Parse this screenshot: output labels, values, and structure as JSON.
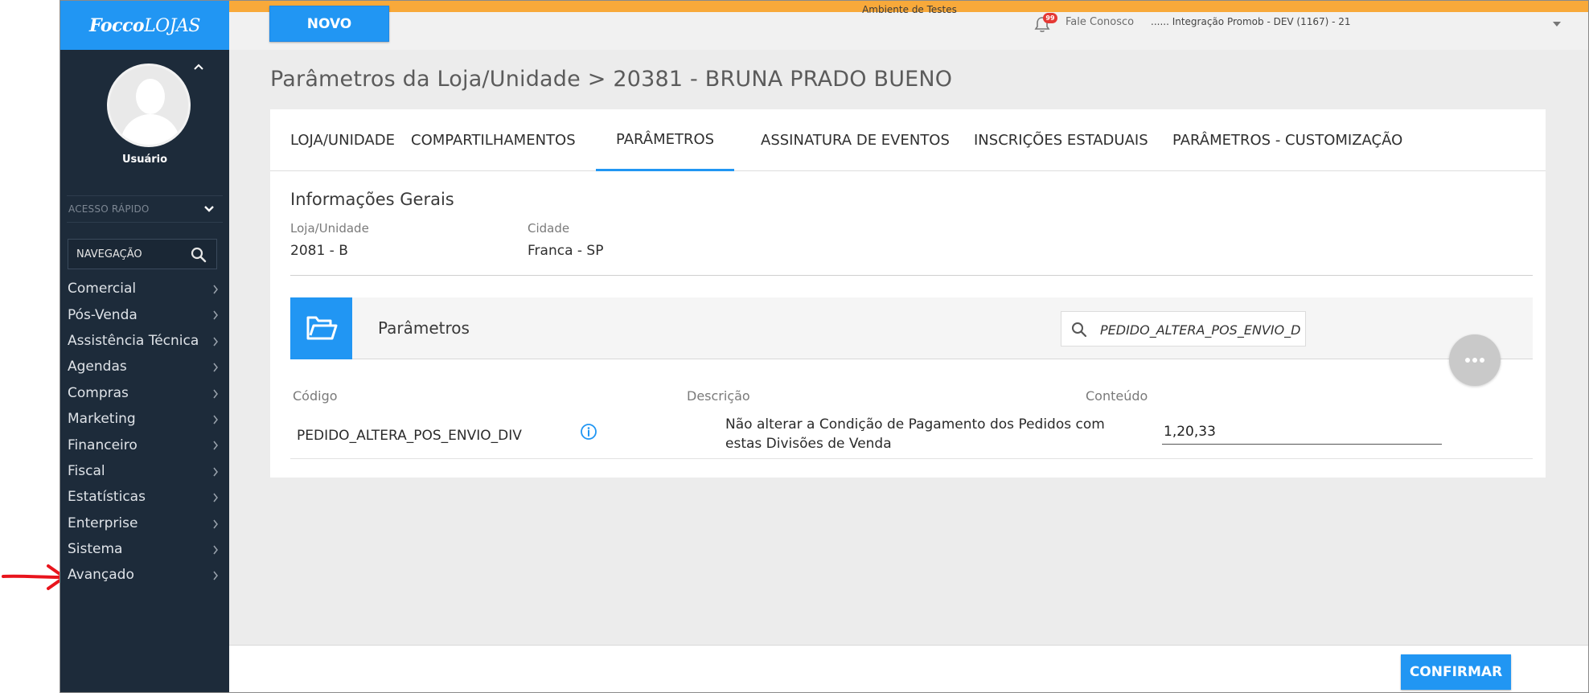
{
  "app": {
    "logo": {
      "bold": "Focco",
      "rest": "LOJAS"
    }
  },
  "environment_banner": "Ambiente de Testes",
  "topbar": {
    "new_button": "NOVO",
    "notification_count": "99",
    "contact": "Fale Conosco",
    "context": "...... Integração Promob - DEV (1167) - 21"
  },
  "sidebar": {
    "user_label": "Usuário",
    "quick_access": "ACESSO RÁPIDO",
    "nav_search": "NAVEGAÇÃO",
    "items": [
      {
        "label": "Comercial"
      },
      {
        "label": "Pós-Venda"
      },
      {
        "label": "Assistência Técnica"
      },
      {
        "label": "Agendas"
      },
      {
        "label": "Compras"
      },
      {
        "label": "Marketing"
      },
      {
        "label": "Financeiro"
      },
      {
        "label": "Fiscal"
      },
      {
        "label": "Estatísticas"
      },
      {
        "label": "Enterprise"
      },
      {
        "label": "Sistema"
      },
      {
        "label": "Avançado"
      }
    ]
  },
  "page": {
    "title": "Parâmetros da Loja/Unidade > 20381 - BRUNA PRADO BUENO",
    "tabs": [
      {
        "label": "LOJA/UNIDADE",
        "active": false
      },
      {
        "label": "COMPARTILHAMENTOS",
        "active": false
      },
      {
        "label": "PARÂMETROS",
        "active": true
      },
      {
        "label": "ASSINATURA DE EVENTOS",
        "active": false
      },
      {
        "label": "INSCRIÇÕES ESTADUAIS",
        "active": false
      },
      {
        "label": "PARÂMETROS - CUSTOMIZAÇÃO",
        "active": false
      }
    ],
    "general_info": {
      "title": "Informações Gerais",
      "store_label": "Loja/Unidade",
      "store_value": "2081 - B",
      "city_label": "Cidade",
      "city_value": "Franca - SP"
    },
    "params": {
      "title": "Parâmetros",
      "search_value": "PEDIDO_ALTERA_POS_ENVIO_DIV",
      "columns": {
        "code": "Código",
        "description": "Descrição",
        "content": "Conteúdo"
      },
      "rows": [
        {
          "code": "PEDIDO_ALTERA_POS_ENVIO_DIV",
          "description": "Não alterar a Condição de Pagamento dos Pedidos com estas Divisões de Venda",
          "content": "1,20,33"
        }
      ]
    }
  },
  "footer": {
    "confirm_button": "CONFIRMAR"
  },
  "colors": {
    "primary": "#2196f3",
    "sidebar": "#1d2b3a",
    "env_banner": "#f8a93a",
    "annotation_arrow": "#e8141c"
  }
}
